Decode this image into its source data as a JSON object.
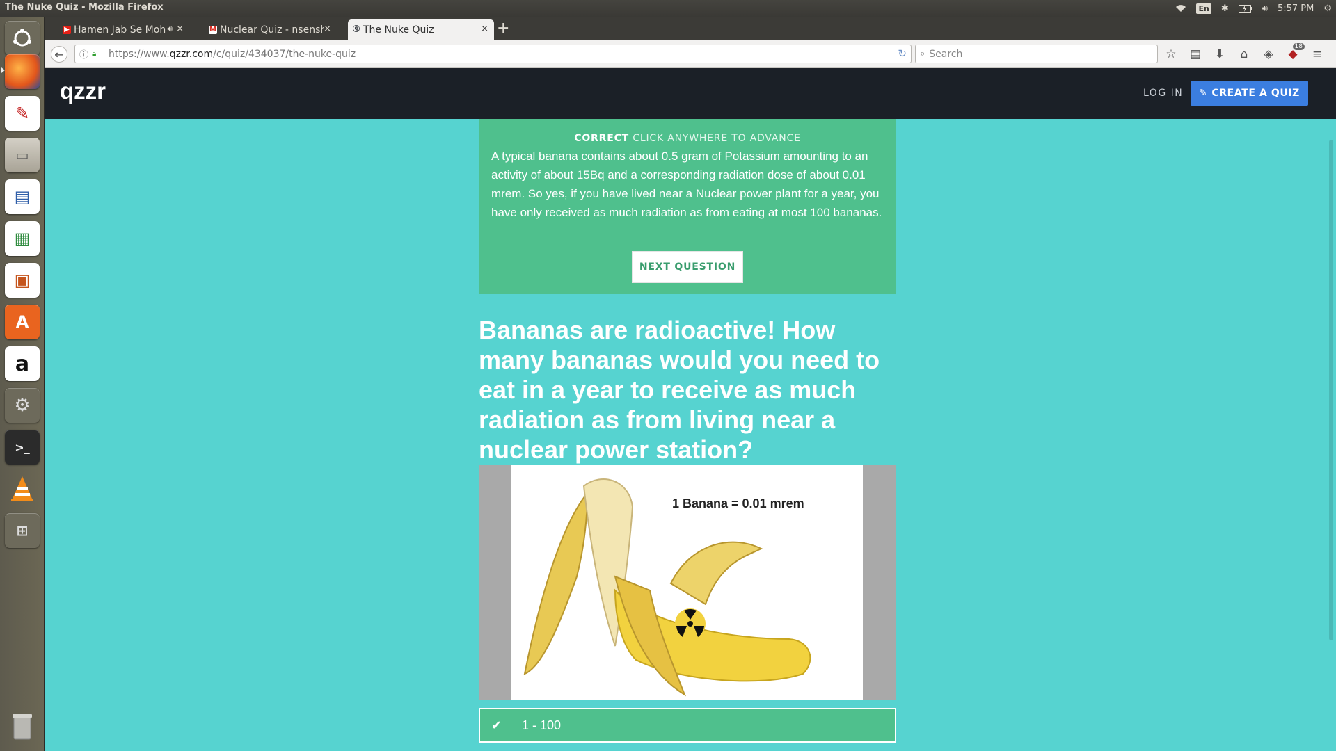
{
  "window": {
    "title": "The Nuke Quiz - Mozilla Firefox"
  },
  "tray": {
    "language": "En",
    "time": "5:57 PM"
  },
  "launcher": {
    "items": [
      {
        "name": "dash-icon"
      },
      {
        "name": "firefox-icon"
      },
      {
        "name": "document-viewer-icon"
      },
      {
        "name": "file-manager-icon"
      },
      {
        "name": "writer-icon"
      },
      {
        "name": "calc-icon"
      },
      {
        "name": "impress-icon"
      },
      {
        "name": "software-center-icon"
      },
      {
        "name": "amazon-icon"
      },
      {
        "name": "system-settings-icon"
      },
      {
        "name": "terminal-icon"
      },
      {
        "name": "vlc-icon"
      },
      {
        "name": "workspace-switcher-icon"
      },
      {
        "name": "trash-icon"
      }
    ]
  },
  "tabs": [
    {
      "label": "Hamen Jab Se Moha",
      "favicon": "youtube-icon",
      "active": false
    },
    {
      "label": "Nuclear Quiz - nsensha",
      "favicon": "gmail-icon",
      "active": false
    },
    {
      "label": "The Nuke Quiz",
      "favicon": "qzzr-icon",
      "active": true
    }
  ],
  "navbar": {
    "url_prefix": "https://www.",
    "url_domain": "qzzr.com",
    "url_path": "/c/quiz/434037/the-nuke-quiz",
    "search_placeholder": "Search",
    "addon_badge": "18"
  },
  "site": {
    "logo": "qzzr",
    "login_label": "LOG IN",
    "create_label": "CREATE A QUIZ"
  },
  "feedback": {
    "status": "CORRECT",
    "advance_hint": "CLICK ANYWHERE TO ADVANCE",
    "explanation": "A typical banana contains about 0.5 gram of Potassium amounting to an activity of about 15Bq and a corresponding radiation dose of about 0.01 mrem. So yes, if you have lived near a Nuclear power plant for a year, you have only received as much radiation as from eating at most 100 bananas.",
    "next_label": "NEXT QUESTION"
  },
  "question": {
    "text": "Bananas are radioactive! How many bananas would you need to eat in a year to receive as much radiation as from living near a nuclear power station?",
    "image_caption": "1 Banana = 0.01 mrem"
  },
  "answer": {
    "label": "1 - 100",
    "selected": true
  },
  "colors": {
    "page_bg": "#56d3d0",
    "correct_green": "#4fc08d",
    "header_dark": "#1b2027",
    "cta_blue": "#3b7ee0"
  }
}
